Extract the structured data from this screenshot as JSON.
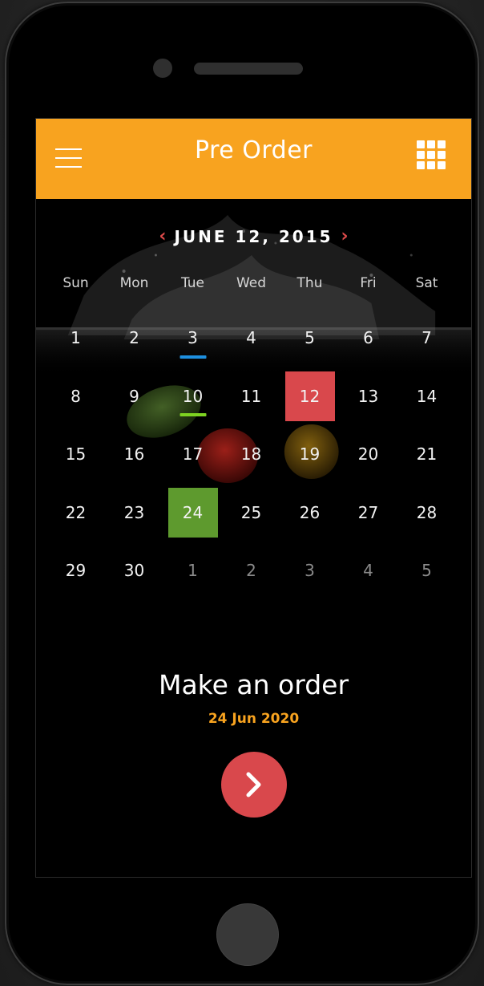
{
  "header": {
    "title": "Pre Order",
    "menu_icon": "hamburger-menu-icon",
    "apps_icon": "grid-apps-icon",
    "background_color": "#F8A31F"
  },
  "calendar": {
    "month_label": "JUNE 12, 2015",
    "prev_icon": "chevron-left-icon",
    "next_icon": "chevron-right-icon",
    "weekdays": [
      "Sun",
      "Mon",
      "Tue",
      "Wed",
      "Thu",
      "Fri",
      "Sat"
    ],
    "days": [
      {
        "label": "1",
        "muted": false
      },
      {
        "label": "2",
        "muted": false
      },
      {
        "label": "3",
        "muted": false,
        "underline": "#1E90E0"
      },
      {
        "label": "4",
        "muted": false
      },
      {
        "label": "5",
        "muted": false
      },
      {
        "label": "6",
        "muted": false
      },
      {
        "label": "7",
        "muted": false
      },
      {
        "label": "8",
        "muted": false
      },
      {
        "label": "9",
        "muted": false
      },
      {
        "label": "10",
        "muted": false,
        "underline": "#7ED321"
      },
      {
        "label": "11",
        "muted": false
      },
      {
        "label": "12",
        "muted": false,
        "highlight": "#D9484C"
      },
      {
        "label": "13",
        "muted": false
      },
      {
        "label": "14",
        "muted": false
      },
      {
        "label": "15",
        "muted": false
      },
      {
        "label": "16",
        "muted": false
      },
      {
        "label": "17",
        "muted": false
      },
      {
        "label": "18",
        "muted": false
      },
      {
        "label": "19",
        "muted": false
      },
      {
        "label": "20",
        "muted": false
      },
      {
        "label": "21",
        "muted": false
      },
      {
        "label": "22",
        "muted": false
      },
      {
        "label": "23",
        "muted": false
      },
      {
        "label": "24",
        "muted": false,
        "highlight": "#5E9A2E"
      },
      {
        "label": "25",
        "muted": false
      },
      {
        "label": "26",
        "muted": false
      },
      {
        "label": "27",
        "muted": false
      },
      {
        "label": "28",
        "muted": false
      },
      {
        "label": "29",
        "muted": false
      },
      {
        "label": "30",
        "muted": false
      },
      {
        "label": "1",
        "muted": true
      },
      {
        "label": "2",
        "muted": true
      },
      {
        "label": "3",
        "muted": true
      },
      {
        "label": "4",
        "muted": true
      },
      {
        "label": "5",
        "muted": true
      }
    ]
  },
  "order": {
    "title": "Make an order",
    "date": "24 Jun 2020",
    "button_icon": "chevron-right-icon",
    "button_color": "#D9484C"
  },
  "colors": {
    "accent_orange": "#F8A31F",
    "selected_red": "#D9484C",
    "selected_green": "#5E9A2E",
    "underline_blue": "#1E90E0",
    "underline_green": "#7ED321"
  }
}
